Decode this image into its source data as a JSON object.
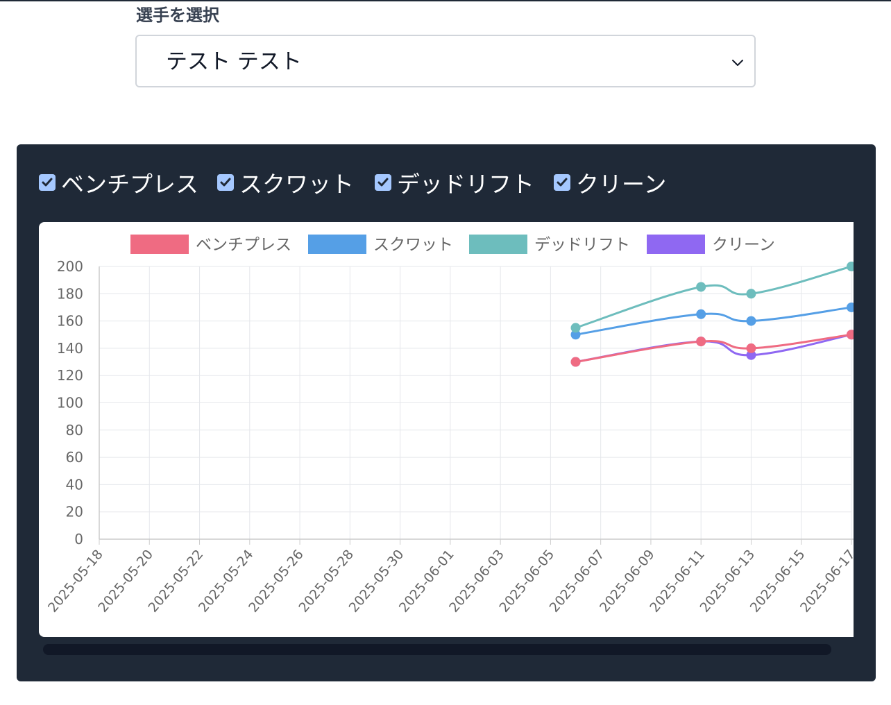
{
  "athlete_selector": {
    "label": "選手を選択",
    "selected": "テスト テスト"
  },
  "toggles": [
    {
      "label": "ベンチプレス",
      "checked": true
    },
    {
      "label": "スクワット",
      "checked": true
    },
    {
      "label": "デッドリフト",
      "checked": true
    },
    {
      "label": "クリーン",
      "checked": true
    }
  ],
  "colors": {
    "panel_bg": "#1f2937",
    "checkbox": "#a5c8ff"
  },
  "chart_data": {
    "type": "line",
    "x_ticks": [
      "2025-05-18",
      "2025-05-20",
      "2025-05-22",
      "2025-05-24",
      "2025-05-26",
      "2025-05-28",
      "2025-05-30",
      "2025-06-01",
      "2025-06-03",
      "2025-06-05",
      "2025-06-07",
      "2025-06-09",
      "2025-06-11",
      "2025-06-13",
      "2025-06-15",
      "2025-06-17"
    ],
    "y_ticks": [
      0,
      20,
      40,
      60,
      80,
      100,
      120,
      140,
      160,
      180,
      200
    ],
    "xlim": [
      "2025-05-18",
      "2025-06-17"
    ],
    "ylim": [
      0,
      200
    ],
    "grid": true,
    "legend_position": "top",
    "series": [
      {
        "name": "ベンチプレス",
        "color": "#ef6b82",
        "points": [
          [
            "2025-06-06",
            130
          ],
          [
            "2025-06-11",
            145
          ],
          [
            "2025-06-13",
            140
          ],
          [
            "2025-06-17",
            150
          ]
        ]
      },
      {
        "name": "スクワット",
        "color": "#559fe6",
        "points": [
          [
            "2025-06-06",
            150
          ],
          [
            "2025-06-11",
            165
          ],
          [
            "2025-06-13",
            160
          ],
          [
            "2025-06-17",
            170
          ]
        ]
      },
      {
        "name": "デッドリフト",
        "color": "#6dbdbd",
        "points": [
          [
            "2025-06-06",
            155
          ],
          [
            "2025-06-11",
            185
          ],
          [
            "2025-06-13",
            180
          ],
          [
            "2025-06-17",
            200
          ]
        ]
      },
      {
        "name": "クリーン",
        "color": "#8f68f2",
        "points": [
          [
            "2025-06-06",
            130
          ],
          [
            "2025-06-11",
            145
          ],
          [
            "2025-06-13",
            135
          ],
          [
            "2025-06-17",
            150
          ]
        ]
      }
    ]
  }
}
